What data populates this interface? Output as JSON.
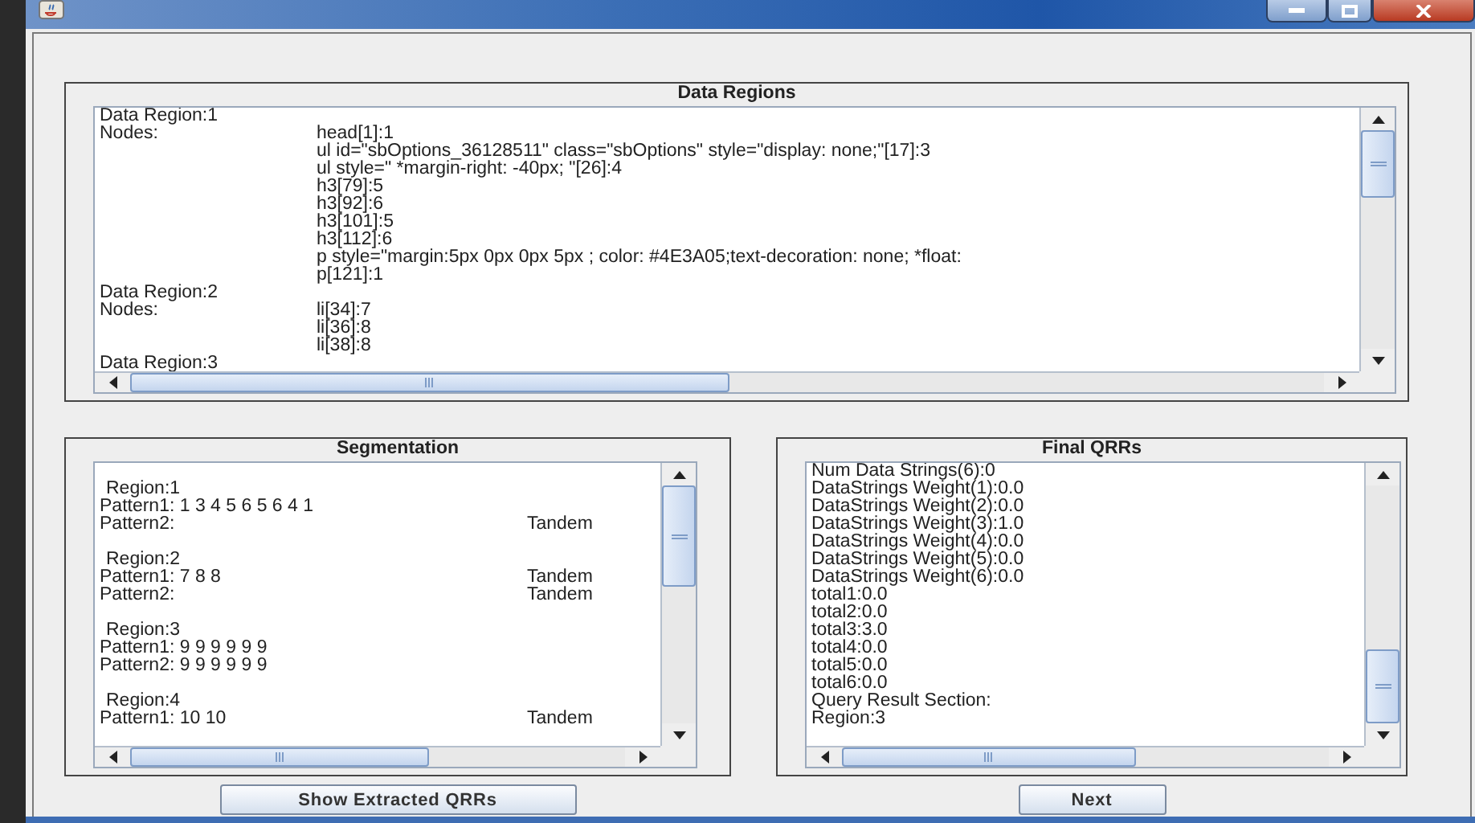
{
  "data_regions": {
    "title": "Data Regions",
    "lines": [
      {
        "label": "Data Region:1"
      },
      {
        "label": "Nodes:",
        "value": "head[1]:1"
      },
      {
        "value": "ul id=\"sbOptions_36128511\" class=\"sbOptions\" style=\"display: none;\"[17]:3"
      },
      {
        "value": "ul style=\" *margin-right: -40px; \"[26]:4"
      },
      {
        "value": "h3[79]:5"
      },
      {
        "value": "h3[92]:6"
      },
      {
        "value": "h3[101]:5"
      },
      {
        "value": "h3[112]:6"
      },
      {
        "value": "p style=\"margin:5px 0px 0px 5px ; color: #4E3A05;text-decoration: none; *float:"
      },
      {
        "value": "p[121]:1"
      },
      {
        "label": "Data Region:2"
      },
      {
        "label": "Nodes:",
        "value": "li[34]:7"
      },
      {
        "value": "li[36]:8"
      },
      {
        "value": "li[38]:8"
      },
      {
        "label": "Data Region:3"
      }
    ]
  },
  "segmentation": {
    "title": "Segmentation",
    "regions": [
      {
        "heading": "Region:1",
        "patterns": [
          {
            "text": "Pattern1: 1 3 4 5 6 5 6 4 1"
          },
          {
            "text": "Pattern2:",
            "tandem": "Tandem"
          }
        ]
      },
      {
        "heading": "Region:2",
        "patterns": [
          {
            "text": "Pattern1: 7 8 8",
            "tandem": "Tandem"
          },
          {
            "text": "Pattern2:",
            "tandem": "Tandem"
          }
        ]
      },
      {
        "heading": "Region:3",
        "patterns": [
          {
            "text": "Pattern1: 9 9 9 9 9 9"
          },
          {
            "text": "Pattern2: 9 9 9 9 9 9"
          }
        ]
      },
      {
        "heading": "Region:4",
        "patterns": [
          {
            "text": "Pattern1: 10 10",
            "tandem": "Tandem"
          }
        ]
      }
    ]
  },
  "final_qrrs": {
    "title": "Final QRRs",
    "lines": [
      "Num Data Strings(6):0",
      "DataStrings Weight(1):0.0",
      "DataStrings Weight(2):0.0",
      "DataStrings Weight(3):1.0",
      "DataStrings Weight(4):0.0",
      "DataStrings Weight(5):0.0",
      "DataStrings Weight(6):0.0",
      "total1:0.0",
      "total2:0.0",
      "total3:3.0",
      "total4:0.0",
      "total5:0.0",
      "total6:0.0",
      "Query Result Section:",
      "Region:3"
    ]
  },
  "buttons": [
    {
      "label": "Show Extracted QRRs"
    },
    {
      "label": "Next"
    }
  ]
}
